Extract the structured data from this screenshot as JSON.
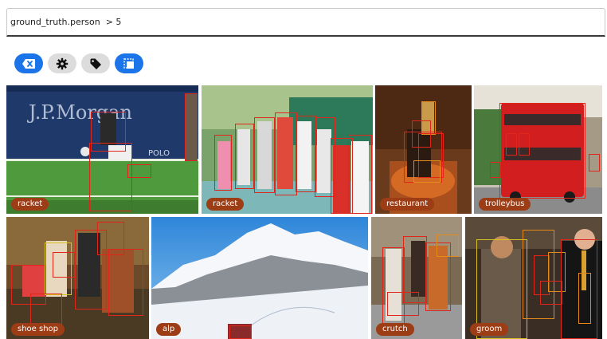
{
  "query": {
    "value": "ground_truth.person  > 5",
    "placeholder": ""
  },
  "toolbar": {
    "buttons": [
      {
        "icon": "clear-filter-icon",
        "style": "blue"
      },
      {
        "icon": "gear-icon",
        "style": "gray"
      },
      {
        "icon": "tag-icon",
        "style": "gray"
      },
      {
        "icon": "select-frames-icon",
        "style": "blue"
      }
    ]
  },
  "tiles": [
    {
      "label": "racket"
    },
    {
      "label": "racket"
    },
    {
      "label": "restaurant"
    },
    {
      "label": "trolleybus"
    },
    {
      "label": "shoe shop"
    },
    {
      "label": "alp"
    },
    {
      "label": "crutch"
    },
    {
      "label": "groom"
    }
  ],
  "scene_text": {
    "sponsor": "J.P.Morgan",
    "polo": "POLO"
  },
  "colors": {
    "accent_blue": "#1b74e8",
    "box_red": "#e0251a",
    "tag_bg": "#9c3d16"
  }
}
